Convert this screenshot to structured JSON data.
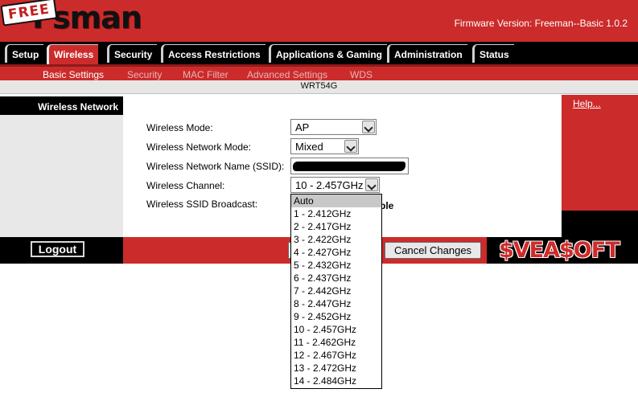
{
  "header": {
    "logo_badge": "FREE",
    "logo_word": "Fsman",
    "firmware": "Firmware Version: Freeman--Basic 1.0.2"
  },
  "tabs": [
    "Setup",
    "Wireless",
    "Security",
    "Access Restrictions",
    "Applications & Gaming",
    "Administration",
    "Status"
  ],
  "active_tab": "Wireless",
  "submenu": [
    "Basic Settings",
    "Security",
    "MAC Filter",
    "Advanced Settings",
    "WDS"
  ],
  "active_submenu": "Basic Settings",
  "model": "WRT54G",
  "section_title": "Wireless Network",
  "help": "Help...",
  "form": {
    "mode_label": "Wireless Mode:",
    "mode_value": "AP",
    "network_mode_label": "Wireless Network Mode:",
    "network_mode_value": "Mixed",
    "ssid_label": "Wireless Network Name (SSID):",
    "channel_label": "Wireless Channel:",
    "channel_value": "10 - 2.457GHz",
    "broadcast_label": "Wireless SSID Broadcast:",
    "broadcast_partial": "ble"
  },
  "channel_options": [
    "Auto",
    "1 - 2.412GHz",
    "2 - 2.417GHz",
    "3 - 2.422GHz",
    "4 - 2.427GHz",
    "5 - 2.432GHz",
    "6 - 2.437GHz",
    "7 - 2.442GHz",
    "8 - 2.447GHz",
    "9 - 2.452GHz",
    "10 - 2.457GHz",
    "11 - 2.462GHz",
    "12 - 2.467GHz",
    "13 - 2.472GHz",
    "14 - 2.484GHz"
  ],
  "highlighted_option": "Auto",
  "buttons": {
    "logout": "Logout",
    "cancel": "Cancel Changes"
  },
  "brand": "$VEA$OFT",
  "colors": {
    "accent_red": "#cc2b2b",
    "bar_black": "#000000"
  }
}
